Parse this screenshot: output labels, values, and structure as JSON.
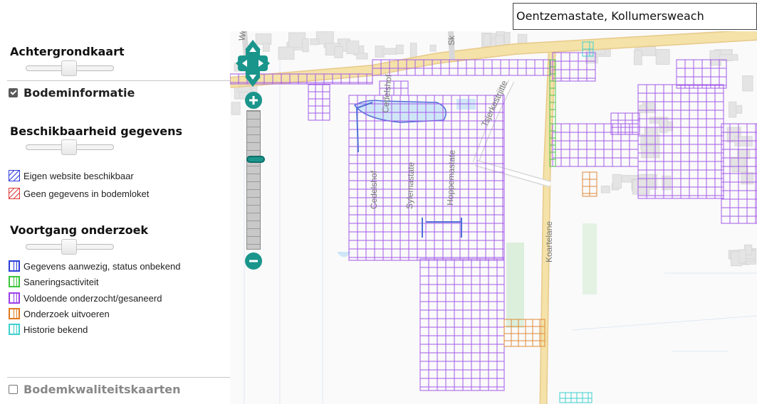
{
  "panel": {
    "achtergrondkaart": {
      "title": "Achtergrondkaart"
    },
    "bodeminformatie": {
      "label": "Bodeminformatie",
      "checked": true
    },
    "beschikbaarheid": {
      "title": "Beschikbaarheid gegevens",
      "legend": [
        {
          "label": "Eigen website beschikbaar",
          "style": "hatch",
          "color": "#2f3ddf"
        },
        {
          "label": "Geen gegevens in bodemloket",
          "style": "hatch",
          "color": "#e03b3b"
        }
      ]
    },
    "voortgang": {
      "title": "Voortgang onderzoek",
      "legend": [
        {
          "label": "Gegevens aanwezig, status onbekend",
          "color": "#2c3fd8"
        },
        {
          "label": "Saneringsactiviteit",
          "color": "#3cc43c"
        },
        {
          "label": "Voldoende onderzocht/gesaneerd",
          "color": "#9b3fe8"
        },
        {
          "label": "Onderzoek uitvoeren",
          "color": "#e07a1f"
        },
        {
          "label": "Historie bekend",
          "color": "#3ed0d0"
        }
      ]
    },
    "bodemkwaliteitskaarten": {
      "label": "Bodemkwaliteitskaarten",
      "checked": false
    }
  },
  "search": {
    "value": "Oentzemastate, Kollumersweach"
  },
  "map": {
    "street_labels": [
      "Wethouder",
      "Sk",
      "Cedelshof",
      "Cedelshof",
      "Sylemastate",
      "Hoppemastate",
      "Tsjerkestrjitte",
      "Koartelane"
    ],
    "colors": {
      "purple": "#a35be8",
      "orange": "#e08a3a",
      "green": "#4cc44c",
      "cyan": "#3ed0d0",
      "blue": "#4f6fd8",
      "road": "#f4e2a8",
      "water": "#cfe6f7",
      "building": "#e4e4e4"
    }
  }
}
